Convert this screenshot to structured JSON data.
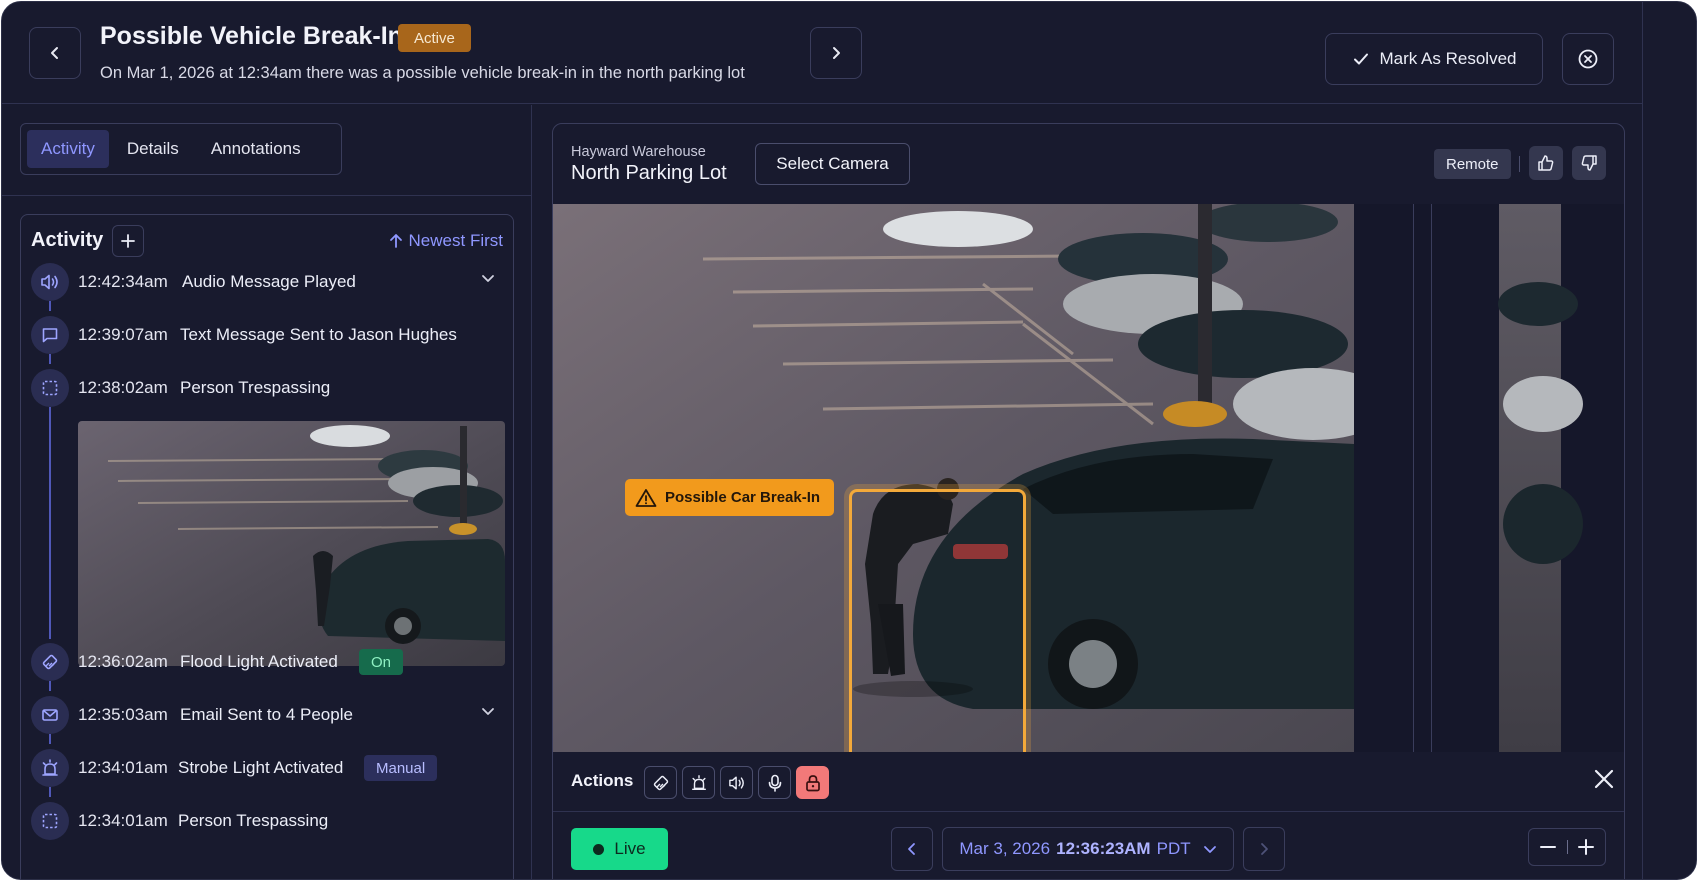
{
  "header": {
    "title": "Possible Vehicle Break-In",
    "status": "Active",
    "description": "On Mar 1, 2026 at 12:34am there was a possible vehicle break-in in the north parking lot",
    "resolve_label": "Mark As Resolved"
  },
  "tabs": [
    {
      "label": "Activity",
      "selected": true
    },
    {
      "label": "Details",
      "selected": false
    },
    {
      "label": "Annotations",
      "selected": false
    }
  ],
  "activity": {
    "title": "Activity",
    "sort_label": "Newest First",
    "events": [
      {
        "time": "12:42:34am",
        "label": "Audio Message Played",
        "icon": "speaker-icon",
        "expandable": true
      },
      {
        "time": "12:39:07am",
        "label": "Text Message Sent to Jason Hughes",
        "icon": "message-icon"
      },
      {
        "time": "12:38:02am",
        "label": "Person Trespassing",
        "icon": "detection-icon"
      },
      {
        "time": "12:36:02am",
        "label": "Flood Light Activated",
        "icon": "floodlight-icon",
        "badge": "On"
      },
      {
        "time": "12:35:03am",
        "label": "Email Sent to 4 People",
        "icon": "mail-icon",
        "expandable": true
      },
      {
        "time": "12:34:01am",
        "label": "Strobe Light Activated",
        "icon": "strobe-icon",
        "badge": "Manual"
      },
      {
        "time": "12:34:01am",
        "label": "Person Trespassing",
        "icon": "detection-icon"
      }
    ]
  },
  "camera": {
    "site": "Hayward Warehouse",
    "name": "North Parking Lot",
    "select_label": "Select Camera",
    "mode": "Remote",
    "alert_label": "Possible Car Break-In"
  },
  "actions": {
    "label": "Actions",
    "buttons": [
      "floodlight-icon",
      "strobe-icon",
      "speaker-icon",
      "microphone-icon",
      "lock-icon"
    ]
  },
  "playback": {
    "live_label": "Live",
    "date": "Mar 3, 2026",
    "time": "12:36:23AM",
    "timezone": "PDT"
  },
  "colors": {
    "background": "#181a2e",
    "accent": "#8f97ff",
    "live": "#17d98a",
    "alert": "#f29a1c",
    "active_badge": "#a8661b",
    "on_badge": "#166b4c",
    "lock": "#f27979"
  }
}
